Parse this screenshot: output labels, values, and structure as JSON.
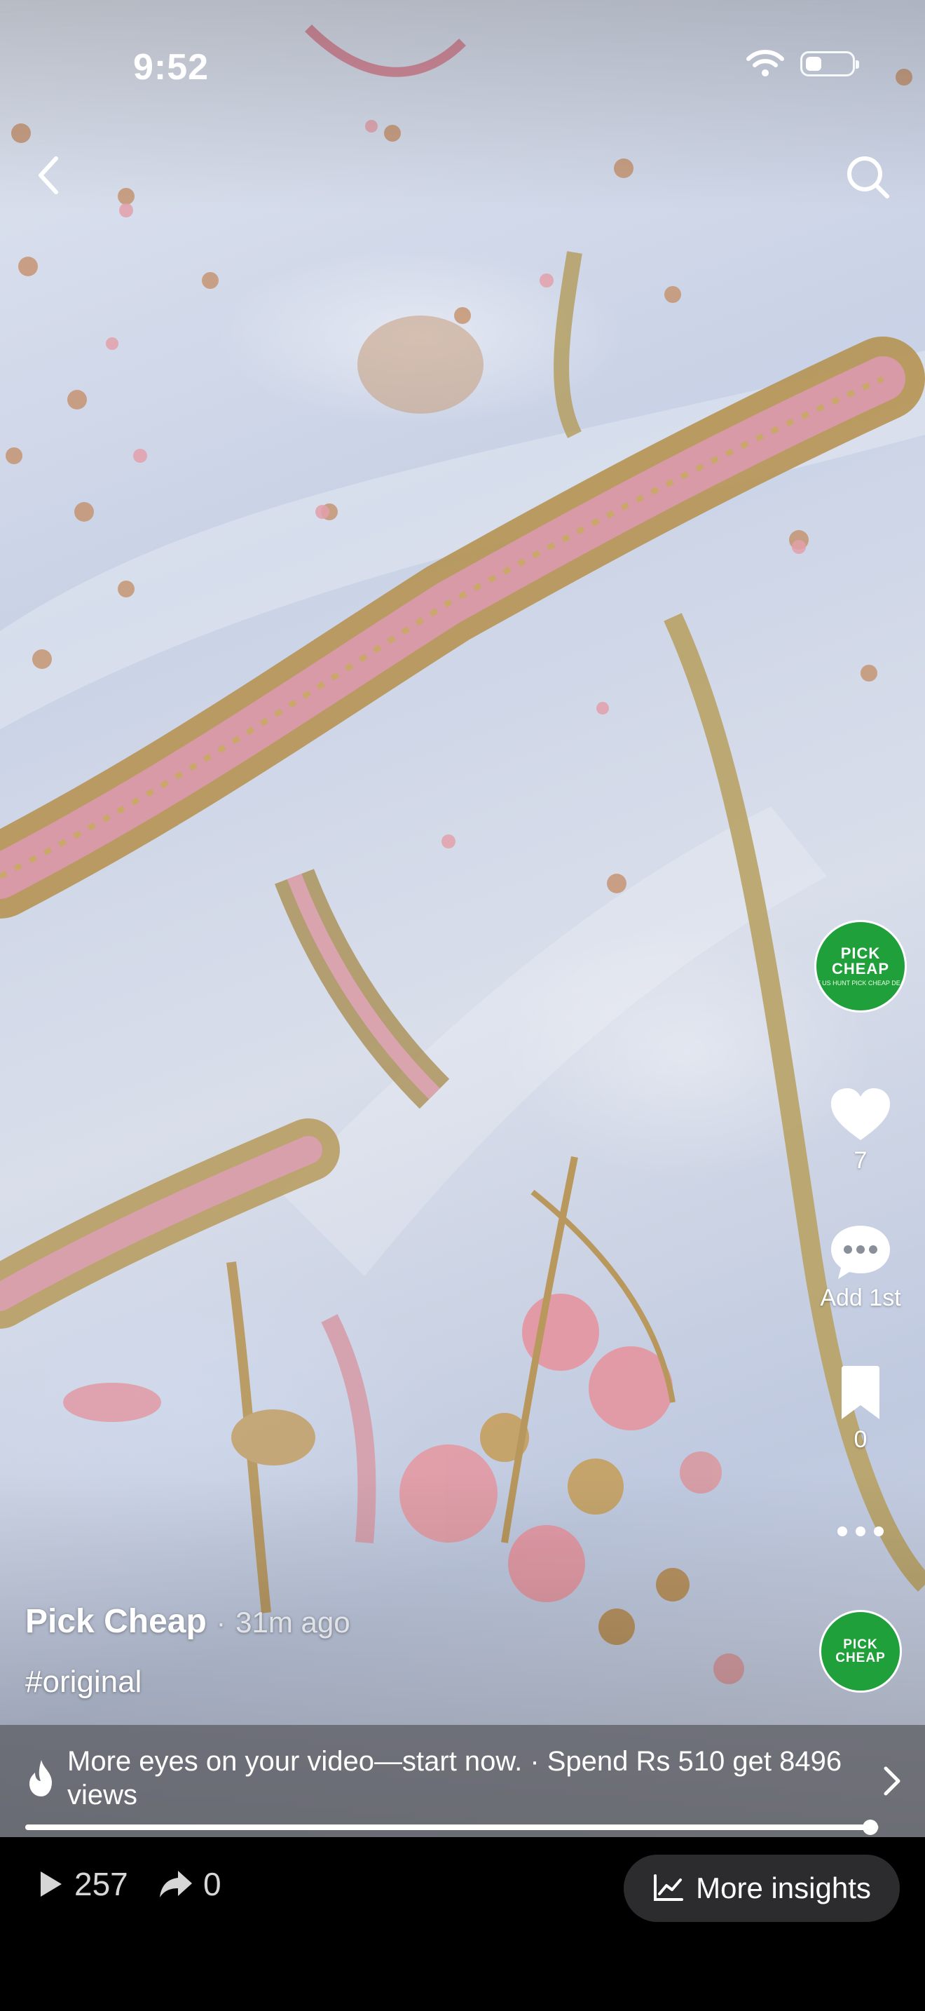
{
  "status_bar": {
    "time": "9:52",
    "battery_level": 0.35,
    "wifi_icon": "wifi-icon"
  },
  "nav": {
    "back_icon": "chevron-left-icon",
    "search_icon": "search-icon"
  },
  "side_actions": {
    "avatar_logo_line1": "PICK",
    "avatar_logo_line2": "CHEAP",
    "avatar_logo_small": "LET US HUNT PICK CHEAP DEALS",
    "likes": "7",
    "comments_label": "Add 1st",
    "saves": "0",
    "more_icon": "more-horizontal-icon"
  },
  "post": {
    "author": "Pick Cheap",
    "separator": "·",
    "time_ago": "31m ago",
    "caption": "#original"
  },
  "promo": {
    "icon": "flame-icon",
    "text": "More eyes on your video—start now. · Spend Rs 510 get 8496 views"
  },
  "playback": {
    "progress": 0.99
  },
  "bottom": {
    "plays": "257",
    "shares": "0",
    "insights_label": "More insights"
  },
  "colors": {
    "avatar_green": "#1fa03a",
    "pill_bg": "#2c2c2e"
  }
}
